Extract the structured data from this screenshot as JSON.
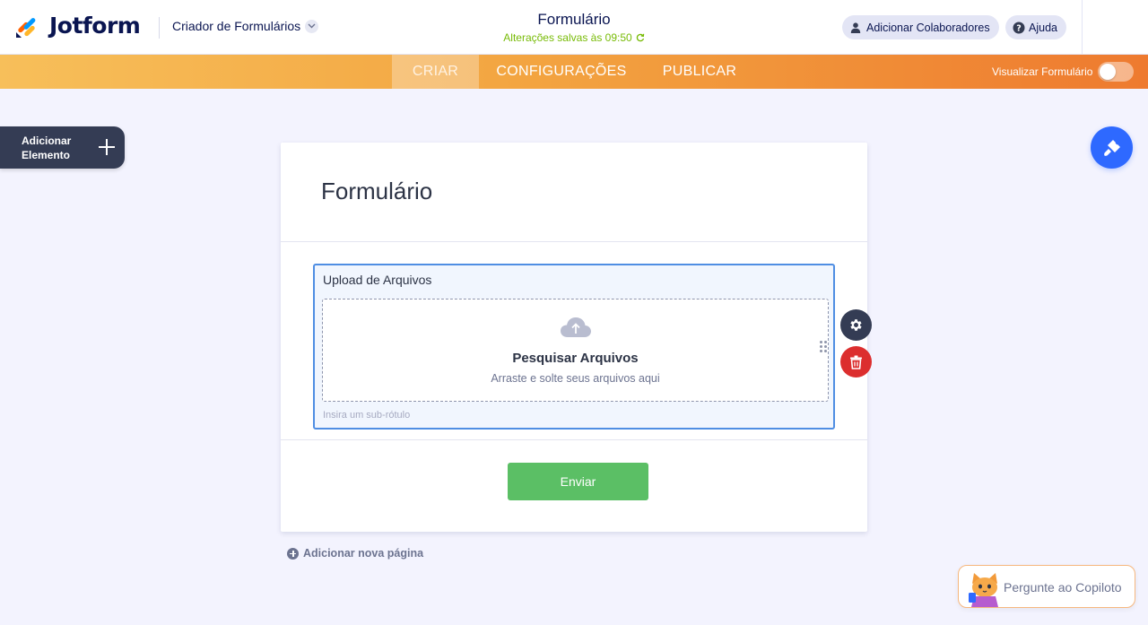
{
  "header": {
    "logo_text": "Jotform",
    "builder_label": "Criador de Formulários",
    "form_title": "Formulário",
    "saved_status": "Alterações salvas às 09:50",
    "collab_button": "Adicionar Colaboradores",
    "help_button": "Ajuda"
  },
  "nav": {
    "tabs": [
      {
        "label": "CRIAR",
        "active": true
      },
      {
        "label": "CONFIGURAÇÕES",
        "active": false
      },
      {
        "label": "PUBLICAR",
        "active": false
      }
    ],
    "preview_label": "Visualizar Formulário",
    "preview_enabled": false
  },
  "sidebar": {
    "add_element_line1": "Adicionar",
    "add_element_line2": "Elemento"
  },
  "form": {
    "title": "Formulário",
    "upload": {
      "label": "Upload de Arquivos",
      "button_text": "Pesquisar Arquivos",
      "drag_text": "Arraste e solte seus arquivos aqui",
      "sublabel_placeholder": "Insira um sub-rótulo"
    },
    "submit_label": "Enviar"
  },
  "footer": {
    "add_page": "Adicionar nova página",
    "copilot": "Pergunte ao Copiloto"
  },
  "colors": {
    "accent_blue": "#2e69ff",
    "submit_green": "#5bbf65",
    "delete_red": "#dc2e2e",
    "nav_orange_start": "#f7bf5a",
    "nav_orange_end": "#ee7a2f",
    "saved_green": "#78bb07"
  },
  "icons": {
    "logo": "jotform-logo-icon",
    "chevron": "chevron-down-icon",
    "saved": "refresh-icon",
    "collab": "user-icon",
    "help": "question-icon",
    "add": "plus-icon",
    "designer": "paint-roller-icon",
    "upload": "cloud-upload-icon",
    "drag": "drag-handle-icon",
    "settings": "gear-icon",
    "delete": "trash-icon",
    "copilot": "cat-avatar-icon"
  }
}
